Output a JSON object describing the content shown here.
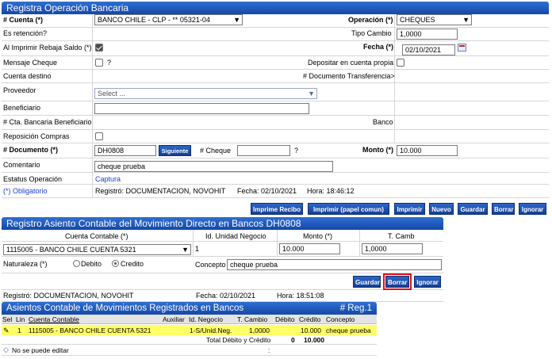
{
  "section1": {
    "title": "Registra Operación Bancaria",
    "cuenta_label": "# Cuenta (*)",
    "cuenta_value": "BANCO CHILE - CLP - ** 05321-04",
    "operacion_label": "Operación (*)",
    "operacion_value": "CHEQUES",
    "es_retencion_label": "Es retención?",
    "tipo_cambio_label": "Tipo Cambio",
    "tipo_cambio_value": "1,0000",
    "rebaja_saldo_label": "Al Imprimir Rebaja Saldo (*)",
    "fecha_label": "Fecha (*)",
    "fecha_value": "02/10/2021",
    "mensaje_cheque_label": "Mensaje Cheque",
    "question_mark": "?",
    "depositar_label": "Depositar en cuenta propia",
    "cuenta_destino_label": "Cuenta destino",
    "doc_transferencia_label": "# Documento Transferencia>",
    "proveedor_label": "Proveedor",
    "proveedor_placeholder": "Select ...",
    "beneficiario_label": "Beneficiario",
    "cta_beneficiario_label": "# Cta. Bancaria Beneficiario",
    "banco_label": "Banco",
    "reposicion_label": "Reposición Compras",
    "documento_label": "# Documento (*)",
    "documento_value": "DH0808",
    "siguiente_label": "Siguiente",
    "cheque_label": "# Cheque",
    "cheque_value": "",
    "monto_label": "Monto (*)",
    "monto_value": "10.000",
    "comentario_label": "Comentario",
    "comentario_value": "cheque prueba",
    "estatus_label": "Estatus Operación",
    "estatus_value": "Captura",
    "obligatorio_label": "(*) Obligatorio",
    "registro_text": "Registró: DOCUMENTACION, NOVOHIT",
    "fecha_reg_text": "Fecha: 02/10/2021",
    "hora_text": "Hora: 18:46:12",
    "buttons": [
      "Imprime Recibo",
      "Imprimir (papel comun)",
      "Imprimir",
      "Nuevo",
      "Guardar",
      "Borrar",
      "Ignorar"
    ]
  },
  "section2": {
    "title": "Registro Asiento Contable del Movimiento Directo en Bancos DH0808",
    "col_cuenta": "Cuenta Contable (*)",
    "col_id_unidad": "Id. Unidad Negocio",
    "col_monto": "Monto (*)",
    "col_tcamb": "T. Camb",
    "cuenta_value": "1115005 - BANCO CHILE CUENTA 5321",
    "id_unidad_value": "1",
    "monto_value": "10.000",
    "tcamb_value": "1,0000",
    "naturaleza_label": "Naturaleza (*)",
    "debito_label": "Debito",
    "credito_label": "Credito",
    "concepto_label": "Concepto",
    "concepto_value": "cheque prueba",
    "buttons": [
      "Guardar",
      "Borrar",
      "Ignorar"
    ],
    "registro_text": "Registró: DOCUMENTACION, NOVOHIT",
    "fecha_reg_text": "Fecha: 02/10/2021",
    "hora_text": "Hora: 18:51:08"
  },
  "section3": {
    "title": "Asientos Contable de Movimientos Registrados en Bancos",
    "reg_count": "# Reg.1",
    "columns": [
      "Sel",
      "Lin",
      "Cuenta Contable",
      "Auxiliar",
      "Id. Negocio",
      "T. Cambio",
      "Débito",
      "Crédito",
      "Concepto"
    ],
    "row": {
      "lin": "1",
      "cuenta": "1115005 - BANCO CHILE CUENTA 5321",
      "auxiliar": "",
      "id_negocio": "1-S/Unid.Neg.",
      "t_cambio": "1,0000",
      "debito": "",
      "credito": "10.000",
      "concepto": "cheque prueba"
    },
    "total_label": "Total Débito y Crédito",
    "total_debito": "0",
    "total_credito": "10.000",
    "footer_note": "No se puede editar",
    "footer_sep": ":"
  }
}
